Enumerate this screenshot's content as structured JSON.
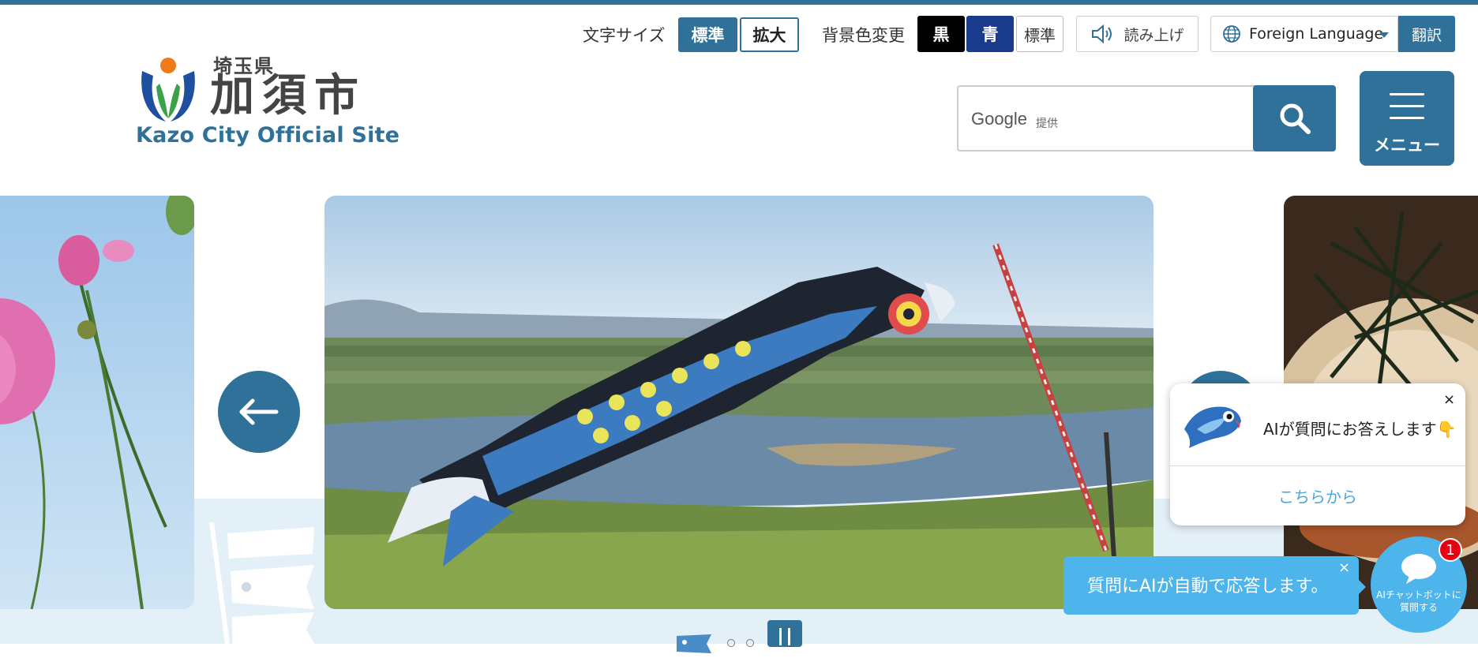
{
  "logo": {
    "prefecture": "埼玉県",
    "city": "加須市",
    "english": "Kazo City Official Site"
  },
  "utility": {
    "font_size_label": "文字サイズ",
    "font_standard": "標準",
    "font_large": "拡大",
    "bg_label": "背景色変更",
    "bg_black": "黒",
    "bg_blue": "青",
    "bg_standard": "標準",
    "read_aloud": "読み上げ",
    "foreign_language": "Foreign Language",
    "translate": "翻訳"
  },
  "search": {
    "brand": "Google",
    "provided": "提供"
  },
  "menu": {
    "label": "メニュー"
  },
  "chat": {
    "card_title": "AIが質問にお答えします👇",
    "card_link": "こちらから",
    "close_symbol": "×",
    "bubble_text": "質問にAIが自動で応答します。",
    "fab_label": "AIチャットボットに\n質問する",
    "badge_count": "1"
  },
  "colors": {
    "primary": "#2f7199",
    "chat": "#4db4ec",
    "badge": "#e60012"
  }
}
